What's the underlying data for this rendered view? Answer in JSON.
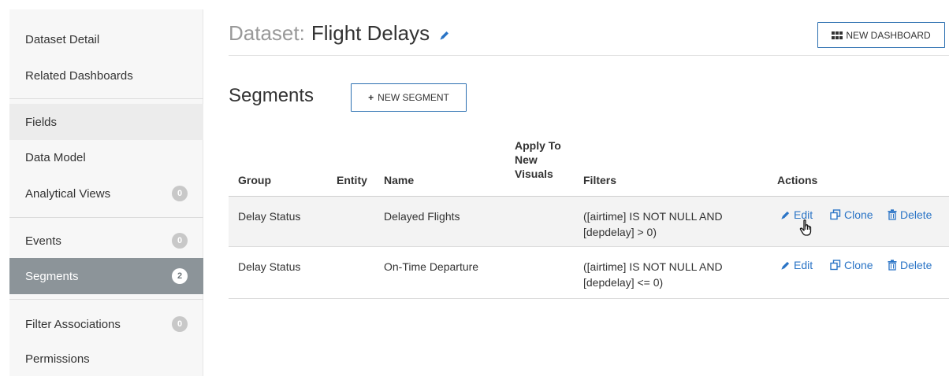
{
  "sidebar": {
    "items": [
      {
        "label": "Dataset Detail"
      },
      {
        "label": "Related Dashboards"
      },
      {
        "label": "Fields"
      },
      {
        "label": "Data Model"
      },
      {
        "label": "Analytical Views",
        "badge": "0"
      },
      {
        "label": "Events",
        "badge": "0"
      },
      {
        "label": "Segments",
        "badge": "2"
      },
      {
        "label": "Filter Associations",
        "badge": "0"
      },
      {
        "label": "Permissions"
      }
    ]
  },
  "header": {
    "prefix": "Dataset:",
    "name": "Flight Delays",
    "new_dashboard_label": "NEW DASHBOARD"
  },
  "segments": {
    "title": "Segments",
    "new_segment_label": "NEW SEGMENT"
  },
  "table": {
    "columns": {
      "group": "Group",
      "entity": "Entity",
      "name": "Name",
      "apply_line1": "Apply To",
      "apply_line2": "New",
      "apply_line3": "Visuals",
      "filters": "Filters",
      "actions": "Actions"
    },
    "rows": [
      {
        "group": "Delay Status",
        "entity": "",
        "name": "Delayed Flights",
        "filter_line1": "([airtime] IS NOT NULL AND",
        "filter_line2": "[depdelay] > 0)"
      },
      {
        "group": "Delay Status",
        "entity": "",
        "name": "On-Time Departure",
        "filter_line1": "([airtime] IS NOT NULL AND",
        "filter_line2": "[depdelay] <= 0)"
      }
    ],
    "actions": {
      "edit": "Edit",
      "clone": "Clone",
      "delete": "Delete"
    }
  },
  "colors": {
    "accent": "#2a74c6",
    "active_sidebar": "#8c9499",
    "button_border": "#2b6fb0"
  }
}
